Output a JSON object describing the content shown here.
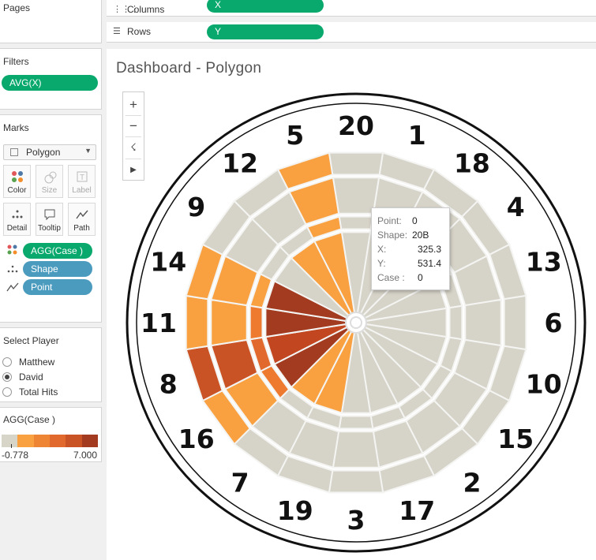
{
  "shelves": {
    "columns": {
      "label": "Columns",
      "pill": "X"
    },
    "rows": {
      "label": "Rows",
      "pill": "Y"
    }
  },
  "pages": {
    "title": "Pages"
  },
  "filters": {
    "title": "Filters",
    "pills": [
      "AVG(X)"
    ]
  },
  "marks": {
    "title": "Marks",
    "mark_type": "Polygon",
    "buttons": [
      "Color",
      "Size",
      "Label",
      "Detail",
      "Tooltip",
      "Path"
    ],
    "fields": [
      {
        "name": "AGG(Case )",
        "kind": "color"
      },
      {
        "name": "Shape",
        "kind": "detail"
      },
      {
        "name": "Point",
        "kind": "path"
      }
    ]
  },
  "player": {
    "title": "Select Player",
    "options": [
      "Matthew",
      "David",
      "Total Hits"
    ],
    "selected": "David"
  },
  "legend": {
    "title": "AGG(Case )",
    "min": "-0.778",
    "max": "7.000",
    "colors": [
      "#d7d4c8",
      "#f9a141",
      "#ee8534",
      "#e2692d",
      "#ca5326",
      "#a23b1f"
    ]
  },
  "dashboard": {
    "title": "Dashboard - Polygon",
    "sector_numbers": [
      "20",
      "1",
      "18",
      "4",
      "13",
      "6",
      "10",
      "15",
      "2",
      "17",
      "3",
      "19",
      "7",
      "16",
      "8",
      "11",
      "14",
      "9",
      "12",
      "5"
    ],
    "base_color": "#d6d3c8",
    "highlights": [
      {
        "sector": "5",
        "double": "#f9a141",
        "outer_single": "#f9a141",
        "triple": "#f9a141",
        "inner_single": "#f9a141"
      },
      {
        "sector": "12",
        "inner_single": "#f9a141"
      },
      {
        "sector": "14",
        "double": "#f9a141",
        "outer_single": "#f9a141",
        "triple": "#f9a141",
        "inner_single": "#a23b1f"
      },
      {
        "sector": "11",
        "double": "#f9a141",
        "outer_single": "#f9a141",
        "triple": "#ee7a30",
        "inner_single": "#a23b1f"
      },
      {
        "sector": "8",
        "double": "#ca5326",
        "outer_single": "#ca5326",
        "triple": "#e2692d",
        "inner_single": "#c2461f"
      },
      {
        "sector": "16",
        "double": "#f9a141",
        "outer_single": "#f9a141",
        "triple": "#ee7a30",
        "inner_single": "#a23b1f"
      },
      {
        "sector": "7",
        "inner_single": "#f9a141"
      },
      {
        "sector": "19",
        "inner_single": "#f9a141"
      }
    ]
  },
  "tooltip": {
    "rows": [
      {
        "key": "Point:",
        "value": "0"
      },
      {
        "key": "Shape:",
        "value": "20B"
      },
      {
        "key": "X:",
        "value": "325.3"
      },
      {
        "key": "Y:",
        "value": "531.4"
      },
      {
        "key": "Case :",
        "value": "0"
      }
    ]
  }
}
